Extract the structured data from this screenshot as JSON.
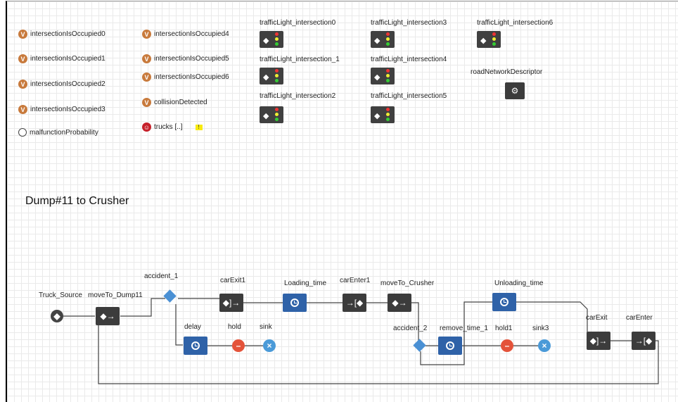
{
  "variables": {
    "col1": [
      "intersectionIsOccupied0",
      "intersectionIsOccupied1",
      "intersectionIsOccupied2",
      "intersectionIsOccupied3"
    ],
    "col2": [
      "intersectionIsOccupied4",
      "intersectionIsOccupied5",
      "intersectionIsOccupied6"
    ],
    "collision": "collisionDetected",
    "parameter": "malfunctionProbability",
    "agents": "trucks [..]",
    "var_icon_letter": "V",
    "warning_badge": "!"
  },
  "traffic_lights": [
    "trafficLight_intersection0",
    "trafficLight_intersection_1",
    "trafficLight_intersection2",
    "trafficLight_intersection3",
    "trafficLight_intersection4",
    "trafficLight_intersection5",
    "trafficLight_intersection6"
  ],
  "road_network": "roadNetworkDescriptor",
  "section_title": "Dump#11 to Crusher",
  "flowchart": {
    "truck_source": "Truck_Source",
    "move_to_dump": "moveTo_Dump11",
    "accident_1": "accident_1",
    "car_exit_1": "carExit1",
    "loading_time": "Loading_time",
    "car_enter_1": "carEnter1",
    "move_to_crusher": "moveTo_Crusher",
    "delay": "delay",
    "hold": "hold",
    "sink": "sink",
    "accident_2": "accident_2",
    "remove_time_1": "remove_time_1",
    "hold1": "hold1",
    "sink3": "sink3",
    "unloading_time": "Unloading_time",
    "car_exit": "carExit",
    "car_enter": "carEnter"
  },
  "colors": {
    "variable": "#c87a3c",
    "agent": "#c6202a",
    "process_blue": "#2f62a8",
    "hold_red": "#e4533a",
    "sink_blue": "#4a9ad8"
  }
}
